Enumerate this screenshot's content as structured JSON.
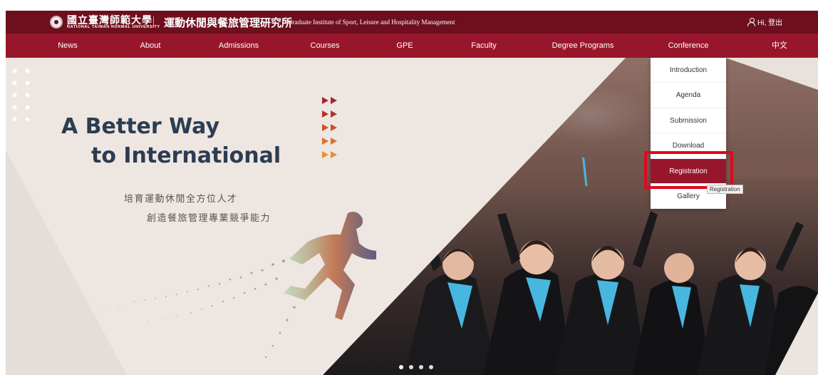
{
  "header": {
    "university_cn": "國立臺灣師範大學",
    "university_en": "NATIONAL TAIWAN NORMAL UNIVERSITY",
    "institute_cn": "運動休閒與餐旅管理研究所",
    "institute_en": "Graduate Institute of Sport, Leisure and Hospitality Management",
    "greeting": "Hi, 登出"
  },
  "nav": {
    "items": [
      {
        "label": "News"
      },
      {
        "label": "About"
      },
      {
        "label": "Admissions"
      },
      {
        "label": "Courses"
      },
      {
        "label": "GPE"
      },
      {
        "label": "Faculty"
      },
      {
        "label": "Degree Programs"
      },
      {
        "label": "Conference"
      },
      {
        "label": "中文"
      }
    ]
  },
  "conference_menu": {
    "items": [
      {
        "label": "Introduction"
      },
      {
        "label": "Agenda"
      },
      {
        "label": "Submission"
      },
      {
        "label": "Download"
      },
      {
        "label": "Registration"
      },
      {
        "label": "Gallery"
      }
    ],
    "active_index": 4,
    "tooltip": "Registration"
  },
  "hero": {
    "headline_line1": "A Better Way",
    "headline_line2": "to International",
    "subline1": "培育運動休閒全方位人才",
    "subline2": "創造餐旅管理專業競爭能力",
    "slides": 4,
    "active_slide": 0
  },
  "colors": {
    "header_bg": "#6e0f1e",
    "nav_bg": "#98162b",
    "headline": "#2c3d52",
    "highlight": "#e0071c"
  }
}
